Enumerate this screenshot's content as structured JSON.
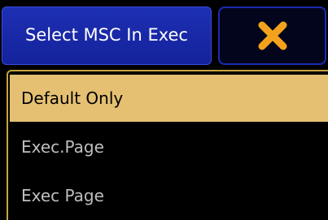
{
  "dialog": {
    "title": "Select MSC In Exec",
    "close_icon": "close-icon",
    "colors": {
      "title_bg": "#1d2fb4",
      "close_border": "#1b2bb0",
      "close_icon": "#f4a21d",
      "selected_bg": "#e5c072",
      "list_border": "#c7a43f"
    }
  },
  "options": {
    "items": [
      {
        "label": "Default Only",
        "selected": true
      },
      {
        "label": "Exec.Page",
        "selected": false
      },
      {
        "label": "Exec Page",
        "selected": false
      }
    ]
  }
}
